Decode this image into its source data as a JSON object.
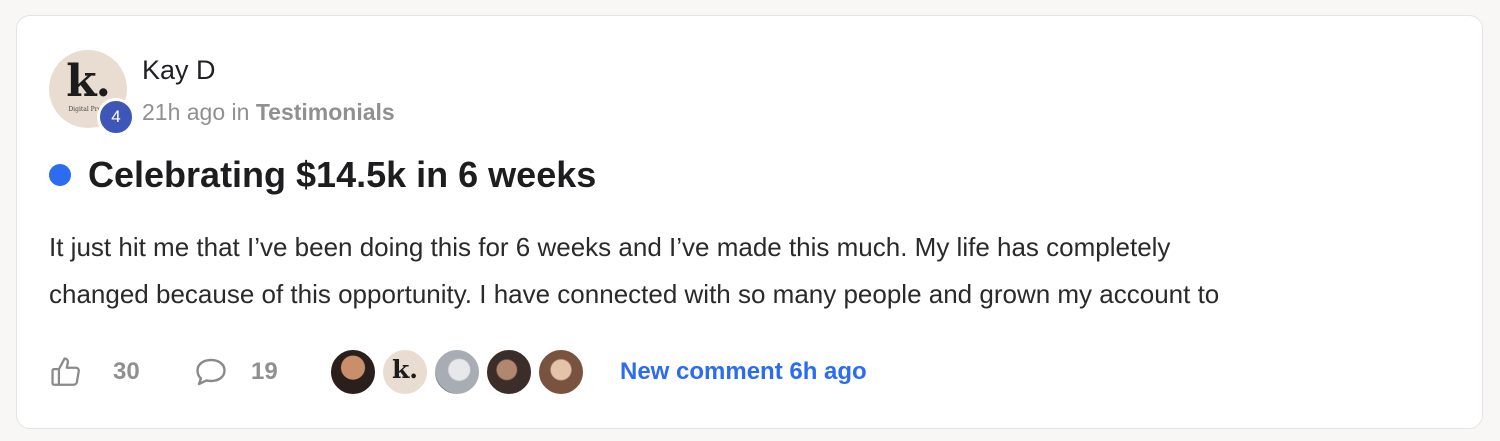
{
  "post": {
    "author": {
      "name": "Kay D",
      "level": "4",
      "avatar_letter": "k.",
      "avatar_subtext": "Digital Profit"
    },
    "time_ago": "21h ago",
    "meta_in": "in",
    "category": "Testimonials",
    "title": "Celebrating $14.5k in 6 weeks",
    "body_lines": [
      "It just hit me that I’ve been doing this for 6 weeks and I’ve made this much. My life has completely",
      "changed because of this opportunity. I have connected with so many people and grown my account to"
    ],
    "unread_dot_color": "#2c6cf0"
  },
  "actions": {
    "like_icon": "thumbs-up-icon",
    "likes": "30",
    "comment_icon": "comment-bubble-icon",
    "comments": "19",
    "commenter_avatars": [
      {
        "kind": "photo",
        "colors": [
          "#2a1f1a",
          "#c98e6a"
        ]
      },
      {
        "kind": "logo",
        "letter": "k."
      },
      {
        "kind": "photo",
        "colors": [
          "#a7adb3",
          "#e7e8ea"
        ]
      },
      {
        "kind": "photo",
        "colors": [
          "#3b2e2a",
          "#b28770"
        ]
      },
      {
        "kind": "photo",
        "colors": [
          "#7a5340",
          "#e4c3aa"
        ]
      }
    ],
    "new_comment": "New comment 6h ago"
  },
  "colors": {
    "accent": "#2c6cf0",
    "level_badge": "#3e56b8",
    "muted_text": "#909090"
  }
}
